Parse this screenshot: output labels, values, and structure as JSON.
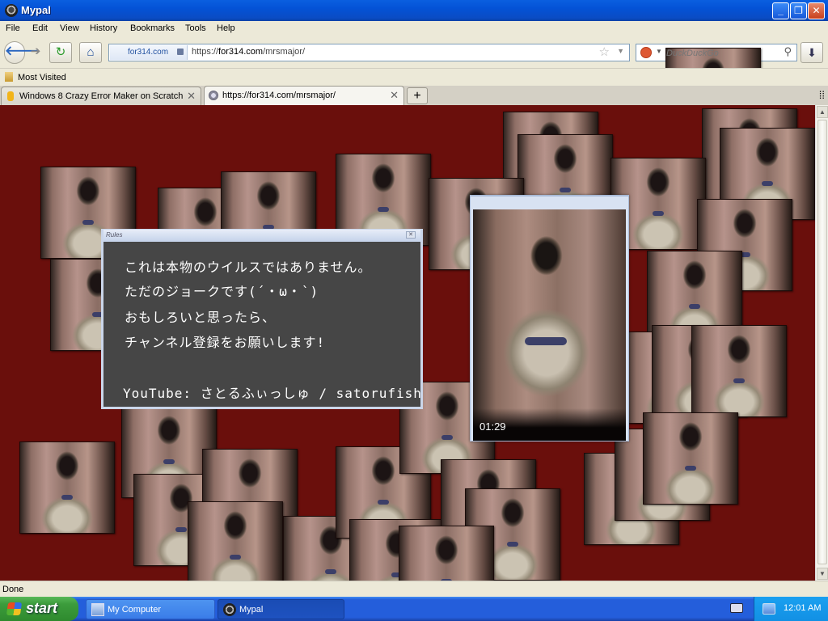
{
  "window": {
    "title": "Mypal"
  },
  "menu": [
    "File",
    "Edit",
    "View",
    "History",
    "Bookmarks",
    "Tools",
    "Help"
  ],
  "nav": {
    "site_identity": "for314.com",
    "url_prefix": "https://",
    "url_host": "for314.com",
    "url_path": "/mrsmajor/",
    "search_placeholder": "DuckDuckGo"
  },
  "bookmarks": {
    "items": [
      "Most Visited"
    ]
  },
  "tabs": [
    {
      "label": "Windows 8 Crazy Error Maker on Scratch",
      "active": false
    },
    {
      "label": "https://for314.com/mrsmajor/",
      "active": true
    }
  ],
  "page": {
    "rules_dialog": {
      "title": "Rules",
      "lines": [
        "これは本物のウイルスではありません。",
        "ただのジョークです(´・ω・`)",
        "おもしろいと思ったら、",
        "チャンネル登録をお願いします!",
        "YouTube:  さとるふぃっしゅ / satorufish"
      ]
    },
    "video": {
      "time": "01:29"
    }
  },
  "status": {
    "text": "Done"
  },
  "taskbar": {
    "start_label": "start",
    "tasks": [
      {
        "label": "My Computer",
        "active": false
      },
      {
        "label": "Mypal",
        "active": true
      }
    ],
    "clock": "12:01 AM"
  },
  "icons": {
    "back": "arrow-left-icon",
    "forward": "arrow-right-icon",
    "reload": "reload-icon",
    "home": "home-icon",
    "lock": "lock-icon",
    "bookmark_star": "star-icon",
    "search": "magnifier-icon",
    "download": "download-arrow-icon"
  },
  "colors": {
    "page_background": "#6a0f0c",
    "dialog_background": "#464646",
    "taskbar": "#245edb",
    "start_button": "#3c9c3c"
  }
}
